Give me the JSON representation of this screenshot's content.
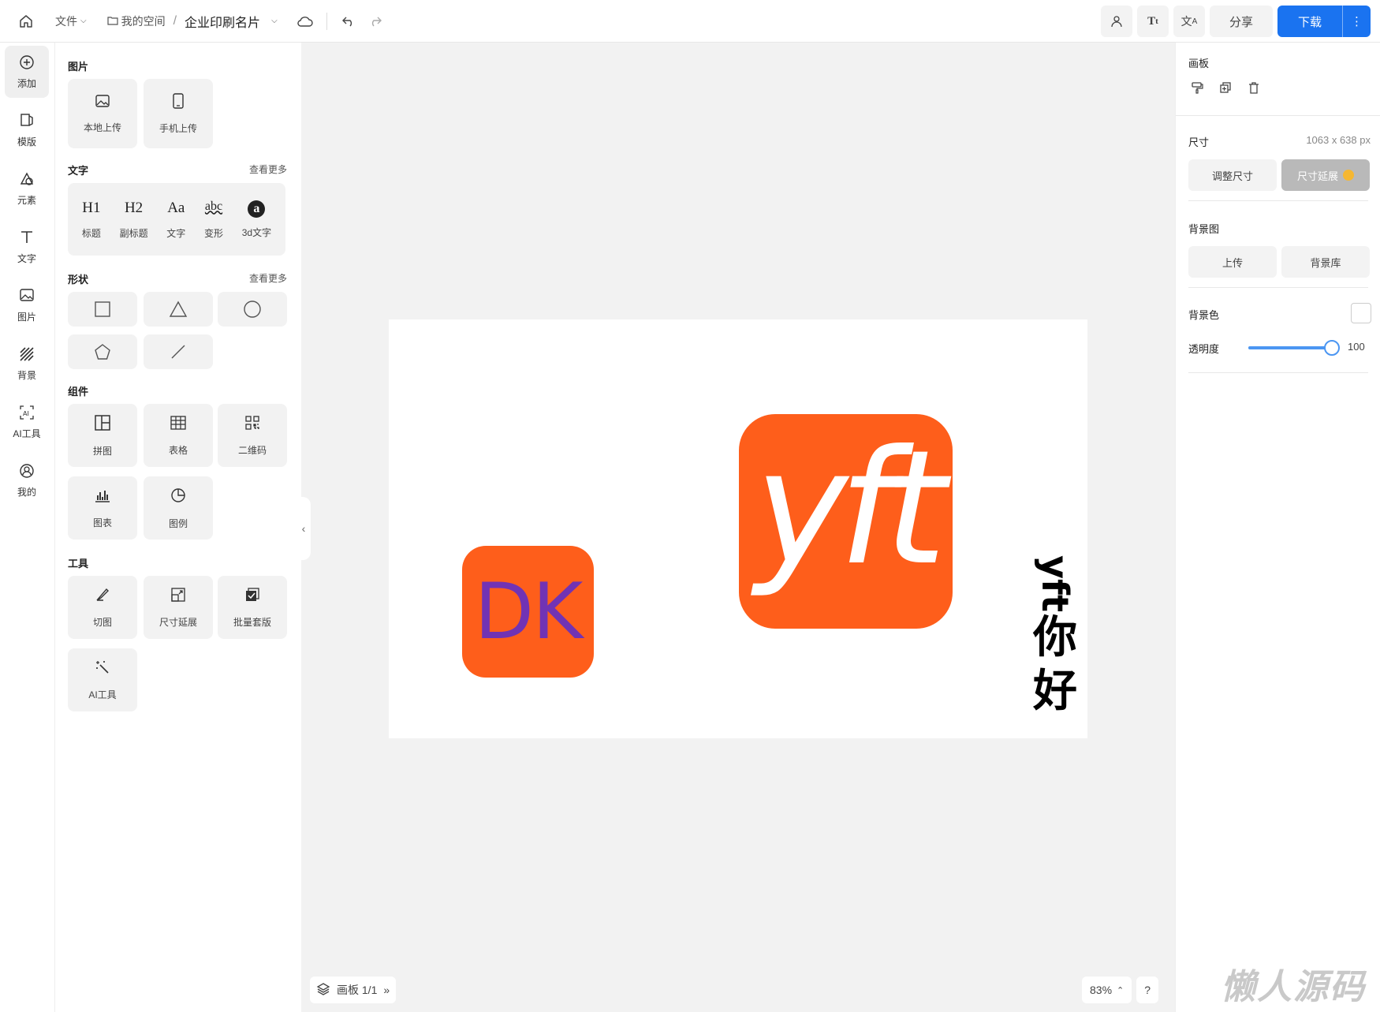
{
  "topbar": {
    "file_menu": "文件",
    "my_space": "我的空间",
    "separator": "/",
    "doc_title": "企业印刷名片",
    "share": "分享",
    "download": "下载"
  },
  "rail": [
    {
      "label": "添加",
      "icon": "add-circle-icon",
      "active": true
    },
    {
      "label": "模版",
      "icon": "template-icon"
    },
    {
      "label": "元素",
      "icon": "shapes-icon"
    },
    {
      "label": "文字",
      "icon": "text-icon"
    },
    {
      "label": "图片",
      "icon": "image-icon"
    },
    {
      "label": "背景",
      "icon": "hatch-icon"
    },
    {
      "label": "AI工具",
      "icon": "ai-icon"
    },
    {
      "label": "我的",
      "icon": "user-icon"
    }
  ],
  "panel": {
    "images": {
      "title": "图片",
      "items": [
        "本地上传",
        "手机上传"
      ]
    },
    "text": {
      "title": "文字",
      "more": "查看更多",
      "items": [
        {
          "glyph": "H1",
          "label": "标题"
        },
        {
          "glyph": "H2",
          "label": "副标题"
        },
        {
          "glyph": "Aa",
          "label": "文字"
        },
        {
          "glyph": "abc",
          "label": "变形"
        },
        {
          "glyph": "a",
          "label": "3d文字"
        }
      ]
    },
    "shapes": {
      "title": "形状",
      "more": "查看更多"
    },
    "components": {
      "title": "组件",
      "items": [
        "拼图",
        "表格",
        "二维码",
        "图表",
        "图例"
      ]
    },
    "tools": {
      "title": "工具",
      "items": [
        "切图",
        "尺寸延展",
        "批量套版",
        "AI工具"
      ]
    }
  },
  "canvas": {
    "logo_dk": "DK",
    "logo_yft": "yft",
    "vertical_text": {
      "rotated": "yft",
      "chars": [
        "你",
        "好"
      ]
    },
    "layers_label": "画板 1/1",
    "zoom": "83%",
    "help": "?"
  },
  "right": {
    "artboard_title": "画板",
    "size_label": "尺寸",
    "size_value": "1063 x 638 px",
    "resize_btn": "调整尺寸",
    "extend_btn": "尺寸延展",
    "bg_image_label": "背景图",
    "upload_btn": "上传",
    "bg_library_btn": "背景库",
    "bg_color_label": "背景色",
    "opacity_label": "透明度",
    "opacity_value": "100",
    "opacity_level": 1.0
  },
  "watermark": "懒人源码",
  "colors": {
    "accent": "#1a73f0",
    "logo_orange": "#fe5e1b",
    "dk_purple": "#7133b4"
  }
}
